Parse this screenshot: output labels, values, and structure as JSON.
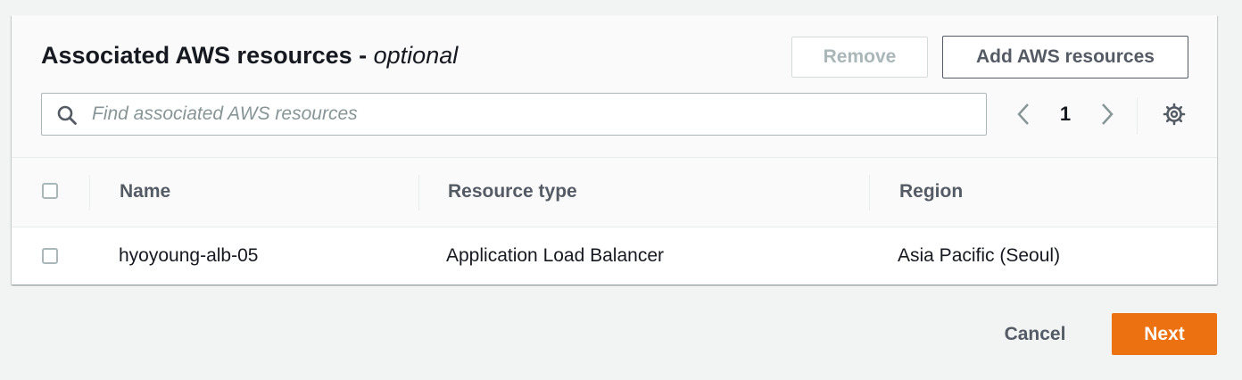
{
  "panel": {
    "title": "Associated AWS resources - ",
    "title_optional": "optional",
    "remove_label": "Remove",
    "add_label": "Add AWS resources"
  },
  "search": {
    "placeholder": "Find associated AWS resources",
    "value": ""
  },
  "pagination": {
    "current_page": "1"
  },
  "table": {
    "columns": [
      "Name",
      "Resource type",
      "Region"
    ],
    "rows": [
      {
        "name": "hyoyoung-alb-05",
        "resource_type": "Application Load Balancer",
        "region": "Asia Pacific (Seoul)"
      }
    ]
  },
  "footer": {
    "cancel_label": "Cancel",
    "next_label": "Next"
  },
  "icons": {
    "search": "search-icon",
    "prev": "chevron-left-icon",
    "next": "chevron-right-icon",
    "settings": "gear-icon"
  },
  "colors": {
    "primary_button": "#ec7211",
    "background": "#f2f3f3",
    "text": "#16191f",
    "secondary_text": "#545b64",
    "disabled": "#aab7b8"
  }
}
